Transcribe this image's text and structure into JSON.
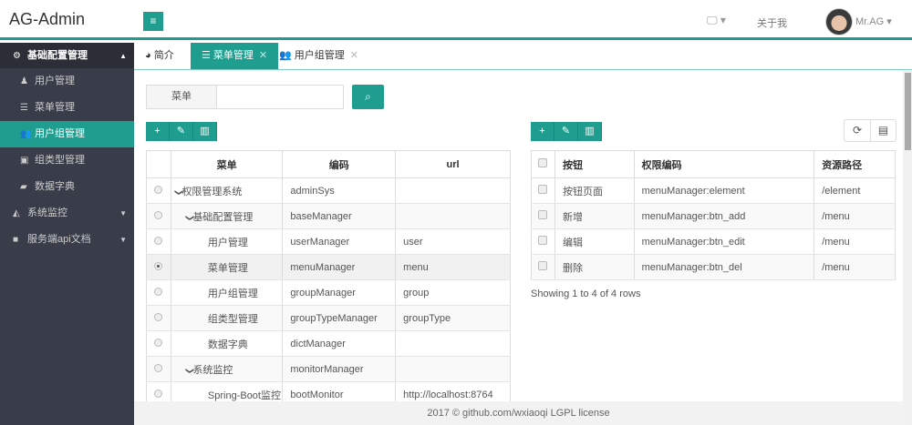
{
  "header": {
    "logo": "AG-Admin",
    "about": "关于我",
    "user": "Mr.AG"
  },
  "sidebar": {
    "items": [
      {
        "label": "基础配置管理",
        "icon": "gear-icon"
      },
      {
        "label": "用户管理",
        "icon": "user-icon"
      },
      {
        "label": "菜单管理",
        "icon": "list-icon"
      },
      {
        "label": "用户组管理",
        "icon": "users-icon"
      },
      {
        "label": "组类型管理",
        "icon": "id-card-icon"
      },
      {
        "label": "数据字典",
        "icon": "book-icon"
      },
      {
        "label": "系统监控",
        "icon": "area-chart-icon"
      },
      {
        "label": "服务端api文档",
        "icon": "folder-icon"
      }
    ]
  },
  "tabs": [
    {
      "label": "简介"
    },
    {
      "label": "菜单管理"
    },
    {
      "label": "用户组管理"
    }
  ],
  "search": {
    "label": "菜单",
    "value": ""
  },
  "menu_table": {
    "headers": [
      "菜单",
      "编码",
      "url"
    ],
    "rows": [
      {
        "name": "权限管理系统",
        "code": "adminSys",
        "url": ""
      },
      {
        "name": "基础配置管理",
        "code": "baseManager",
        "url": ""
      },
      {
        "name": "用户管理",
        "code": "userManager",
        "url": "user"
      },
      {
        "name": "菜单管理",
        "code": "menuManager",
        "url": "menu"
      },
      {
        "name": "用户组管理",
        "code": "groupManager",
        "url": "group"
      },
      {
        "name": "组类型管理",
        "code": "groupTypeManager",
        "url": "groupType"
      },
      {
        "name": "数据字典",
        "code": "dictManager",
        "url": ""
      },
      {
        "name": "系统监控",
        "code": "monitorManager",
        "url": ""
      },
      {
        "name": "Spring-Boot监控",
        "code": "bootMonitor",
        "url": "http://localhost:8764"
      }
    ]
  },
  "element_table": {
    "headers": [
      "按钮",
      "权限编码",
      "资源路径"
    ],
    "rows": [
      {
        "name": "按钮页面",
        "code": "menuManager:element",
        "path": "/element"
      },
      {
        "name": "新增",
        "code": "menuManager:btn_add",
        "path": "/menu"
      },
      {
        "name": "编辑",
        "code": "menuManager:btn_edit",
        "path": "/menu"
      },
      {
        "name": "删除",
        "code": "menuManager:btn_del",
        "path": "/menu"
      }
    ],
    "showing": "Showing 1 to 4 of 4 rows"
  },
  "footer": {
    "text": "2017 ©  github.com/wxiaoqi  LGPL license"
  },
  "colors": {
    "accent": "#1f9e8f",
    "sidebar": "#393d49"
  }
}
